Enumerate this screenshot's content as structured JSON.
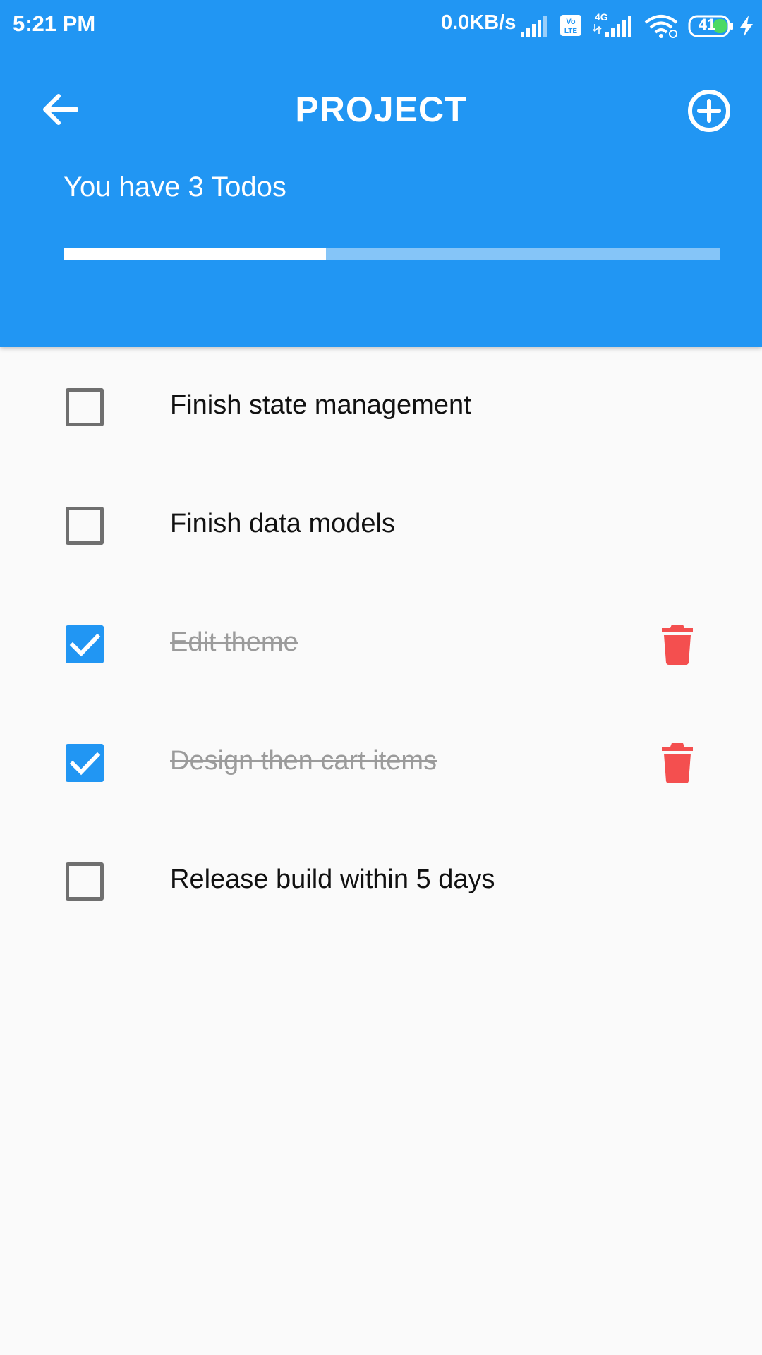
{
  "status_bar": {
    "time": "5:21 PM",
    "net_speed": "0.0KB/s",
    "volte_icon": "volte-lte-icon",
    "network_label": "4G",
    "battery_level": "41"
  },
  "header": {
    "back_icon": "arrow-back-icon",
    "title": "PROJECT",
    "add_icon": "add-circle-icon",
    "subtitle": "You have 3 Todos",
    "progress_fraction": 0.4,
    "colors": {
      "primary": "#2196f3",
      "progress_track": "#90caf9",
      "progress_fill": "#ffffff"
    }
  },
  "todos": [
    {
      "text": "Finish state management",
      "done": false
    },
    {
      "text": "Finish data models",
      "done": false
    },
    {
      "text": "Edit theme",
      "done": true
    },
    {
      "text": "Design then cart items",
      "done": true
    },
    {
      "text": "Release build within 5 days",
      "done": false
    }
  ],
  "delete_icon": "delete-icon",
  "delete_color": "#f44f4f",
  "checkbox_color": "#2196f3"
}
